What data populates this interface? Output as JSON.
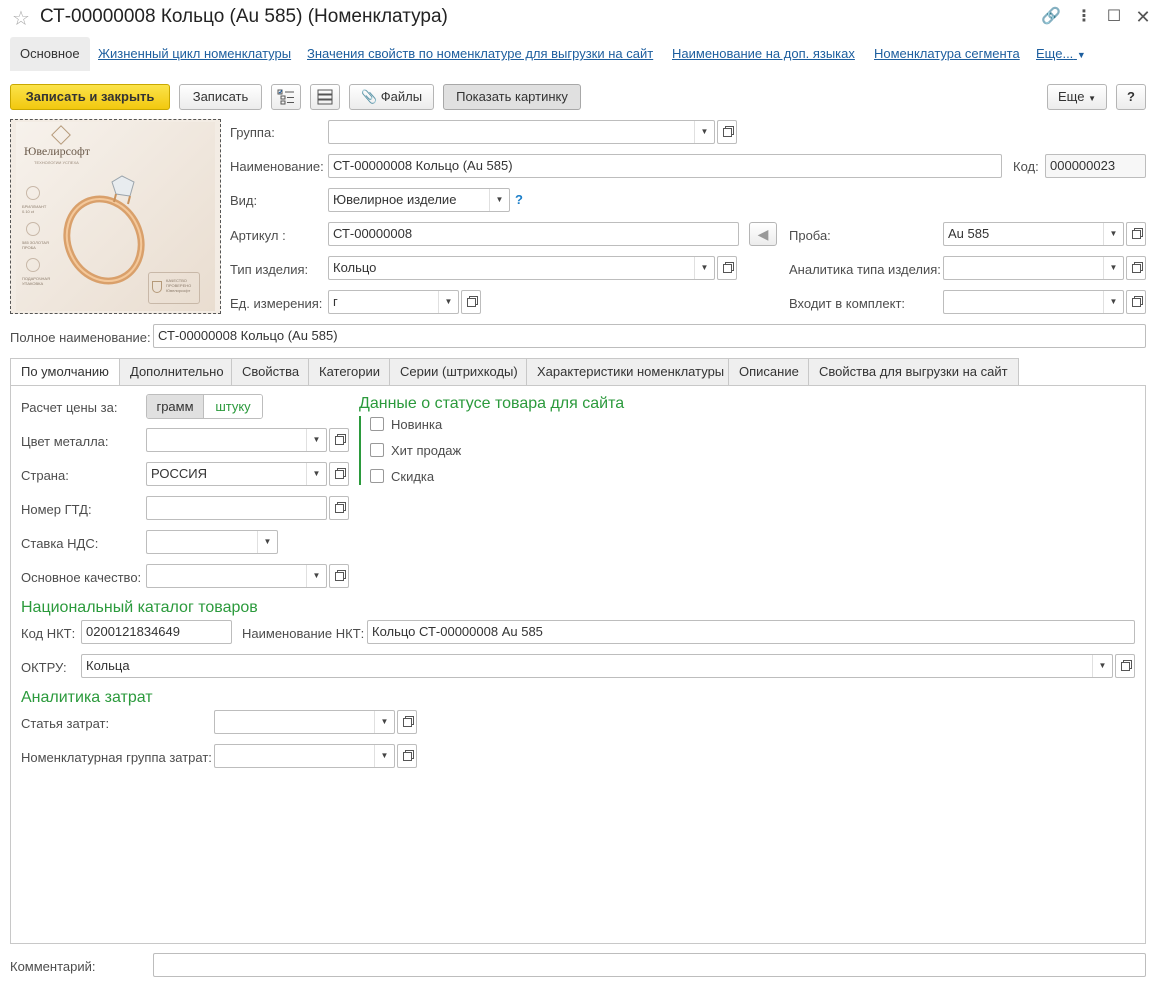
{
  "window": {
    "title": "СТ-00000008 Кольцо (Au 585) (Номенклатура)"
  },
  "nav_tabs": [
    {
      "label": "Основное"
    },
    {
      "label": "Жизненный цикл номенклатуры"
    },
    {
      "label": "Значения свойств по номенклатуре для выгрузки на сайт"
    },
    {
      "label": "Наименование на доп. языках"
    },
    {
      "label": "Номенклатура сегмента"
    },
    {
      "label": "Еще..."
    }
  ],
  "toolbar": {
    "save_close": "Записать и закрыть",
    "save": "Записать",
    "files": "Файлы",
    "show_picture": "Показать картинку",
    "more": "Еще",
    "help": "?"
  },
  "image": {
    "brand": "Ювелирсофт",
    "tagline": "ТЕХНОЛОГИИ УСПЕХА",
    "features": [
      "БРИЛЛИАНТ 0.10 ct",
      "585 ЗОЛОТАЯ ПРОБА",
      "ПОДАРОЧНАЯ УПАКОВКА"
    ],
    "badge": "КАЧЕСТВО ПРОВЕРЕНО Ювелирсофт"
  },
  "form": {
    "group_label": "Группа:",
    "group_value": "",
    "name_label": "Наименование:",
    "name_value": "СТ-00000008 Кольцо (Au 585)",
    "code_label": "Код:",
    "code_value": "000000023",
    "kind_label": "Вид:",
    "kind_value": "Ювелирное изделие",
    "kind_help": "?",
    "article_label": "Артикул :",
    "article_value": "СТ-00000008",
    "proba_label": "Проба:",
    "proba_value": "Au 585",
    "type_label": "Тип изделия:",
    "type_value": "Кольцо",
    "analytics_label": "Аналитика типа изделия:",
    "analytics_value": "",
    "unit_label": "Ед. измерения:",
    "unit_value": "г",
    "kit_label": "Входит в комплект:",
    "kit_value": "",
    "fullname_label": "Полное наименование:",
    "fullname_value": "СТ-00000008 Кольцо (Au 585)"
  },
  "tabs": [
    {
      "label": "По умолчанию"
    },
    {
      "label": "Дополнительно"
    },
    {
      "label": "Свойства"
    },
    {
      "label": "Категории"
    },
    {
      "label": "Серии (штрихкоды)"
    },
    {
      "label": "Характеристики номенклатуры"
    },
    {
      "label": "Описание"
    },
    {
      "label": "Свойства для выгрузки на сайт"
    }
  ],
  "default_tab": {
    "price_calc_label": "Расчет цены за:",
    "price_options": [
      "грамм",
      "штуку"
    ],
    "metal_color_label": "Цвет металла:",
    "metal_color_value": "",
    "country_label": "Страна:",
    "country_value": "РОССИЯ",
    "gtd_label": "Номер ГТД:",
    "gtd_value": "",
    "vat_label": "Ставка НДС:",
    "vat_value": "",
    "quality_label": "Основное качество:",
    "quality_value": "",
    "site_status_title": "Данные о статусе товара для сайта",
    "site_status": [
      {
        "label": "Новинка",
        "checked": false
      },
      {
        "label": "Хит продаж",
        "checked": false
      },
      {
        "label": "Скидка",
        "checked": false
      }
    ],
    "nkt_title": "Национальный каталог товаров",
    "nkt_code_label": "Код НКТ:",
    "nkt_code_value": "0200121834649",
    "nkt_name_label": "Наименование НКТ:",
    "nkt_name_value": "Кольцо СТ-00000008 Au 585",
    "oktru_label": "ОКТРУ:",
    "oktru_value": "Кольца",
    "costs_title": "Аналитика затрат",
    "cost_item_label": "Статья затрат:",
    "cost_item_value": "",
    "cost_group_label": "Номенклатурная группа затрат:",
    "cost_group_value": ""
  },
  "footer": {
    "comment_label": "Комментарий:",
    "comment_value": ""
  }
}
